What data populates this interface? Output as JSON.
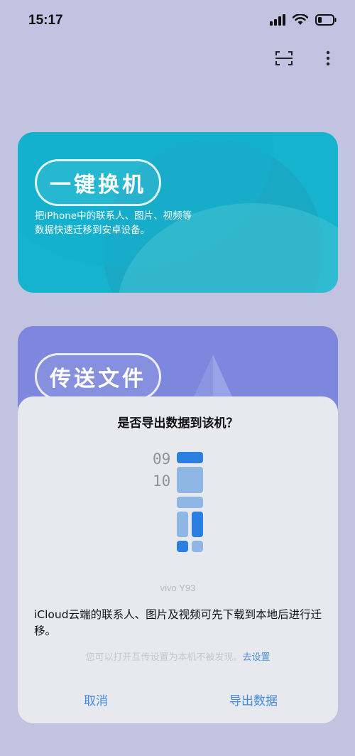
{
  "status_bar": {
    "time": "15:17"
  },
  "cards": [
    {
      "title": "一键换机",
      "description": "把iPhone中的联系人、图片、视频等数据快速迁移到安卓设备。"
    },
    {
      "title": "传送文件"
    }
  ],
  "dialog": {
    "title": "是否导出数据到该机？",
    "graphic_numbers": [
      "09",
      "10"
    ],
    "device_name": "vivo Y93",
    "message": "iCloud云端的联系人、图片及视频可先下载到本地后进行迁移。",
    "hint": "您可以打开互传设置为本机不被发现。",
    "hint_link": "去设置",
    "cancel_label": "取消",
    "confirm_label": "导出数据"
  },
  "colors": {
    "background": "#c2c3e0",
    "card1": "#16b3cf",
    "card2": "#7c87dd",
    "accent": "#3f8ad9"
  }
}
